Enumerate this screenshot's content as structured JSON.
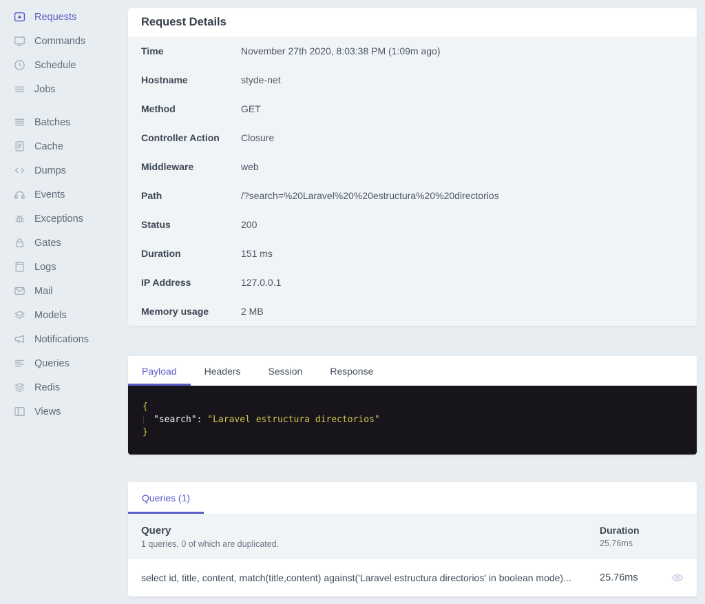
{
  "accent_color": "#5a5dc7",
  "sidebar": {
    "items": [
      {
        "label": "Requests",
        "icon": "requests-icon",
        "active": true
      },
      {
        "label": "Commands",
        "icon": "monitor-icon",
        "active": false
      },
      {
        "label": "Schedule",
        "icon": "clock-icon",
        "active": false
      },
      {
        "label": "Jobs",
        "icon": "lines-icon",
        "active": false
      },
      {
        "label": "Batches",
        "icon": "stack-lines-icon",
        "active": false
      },
      {
        "label": "Cache",
        "icon": "document-icon",
        "active": false
      },
      {
        "label": "Dumps",
        "icon": "code-brackets-icon",
        "active": false
      },
      {
        "label": "Events",
        "icon": "headphones-icon",
        "active": false
      },
      {
        "label": "Exceptions",
        "icon": "bug-icon",
        "active": false
      },
      {
        "label": "Gates",
        "icon": "lock-icon",
        "active": false
      },
      {
        "label": "Logs",
        "icon": "journal-icon",
        "active": false
      },
      {
        "label": "Mail",
        "icon": "envelope-icon",
        "active": false
      },
      {
        "label": "Models",
        "icon": "layers-icon",
        "active": false
      },
      {
        "label": "Notifications",
        "icon": "megaphone-icon",
        "active": false
      },
      {
        "label": "Queries",
        "icon": "query-lines-icon",
        "active": false
      },
      {
        "label": "Redis",
        "icon": "stack-icon",
        "active": false
      },
      {
        "label": "Views",
        "icon": "window-icon",
        "active": false
      }
    ]
  },
  "request_details": {
    "title": "Request Details",
    "rows": [
      {
        "label": "Time",
        "value": "November 27th 2020, 8:03:38 PM (1:09m ago)"
      },
      {
        "label": "Hostname",
        "value": "styde-net"
      },
      {
        "label": "Method",
        "value": "GET"
      },
      {
        "label": "Controller Action",
        "value": "Closure"
      },
      {
        "label": "Middleware",
        "value": "web"
      },
      {
        "label": "Path",
        "value": "/?search=%20Laravel%20%20estructura%20%20directorios"
      },
      {
        "label": "Status",
        "value": "200"
      },
      {
        "label": "Duration",
        "value": "151 ms"
      },
      {
        "label": "IP Address",
        "value": "127.0.0.1"
      },
      {
        "label": "Memory usage",
        "value": "2 MB"
      }
    ]
  },
  "payload_panel": {
    "tabs": [
      {
        "label": "Payload",
        "active": true
      },
      {
        "label": "Headers",
        "active": false
      },
      {
        "label": "Session",
        "active": false
      },
      {
        "label": "Response",
        "active": false
      }
    ],
    "code": {
      "open_brace": "{",
      "key": "\"search\"",
      "colon": ": ",
      "string_value": "\"Laravel estructura directorios\"",
      "close_brace": "}",
      "string_color": "#d0c84a",
      "background": "#18141c"
    }
  },
  "queries_panel": {
    "tab_label": "Queries (1)",
    "columns": {
      "query_label": "Query",
      "query_subtext": "1 queries, 0 of which are duplicated.",
      "duration_label": "Duration",
      "duration_subtext": "25.76ms"
    },
    "rows": [
      {
        "query": "select id, title, content, match(title,content) against('Laravel estructura directorios' in boolean mode)...",
        "duration": "25.76ms"
      }
    ]
  }
}
